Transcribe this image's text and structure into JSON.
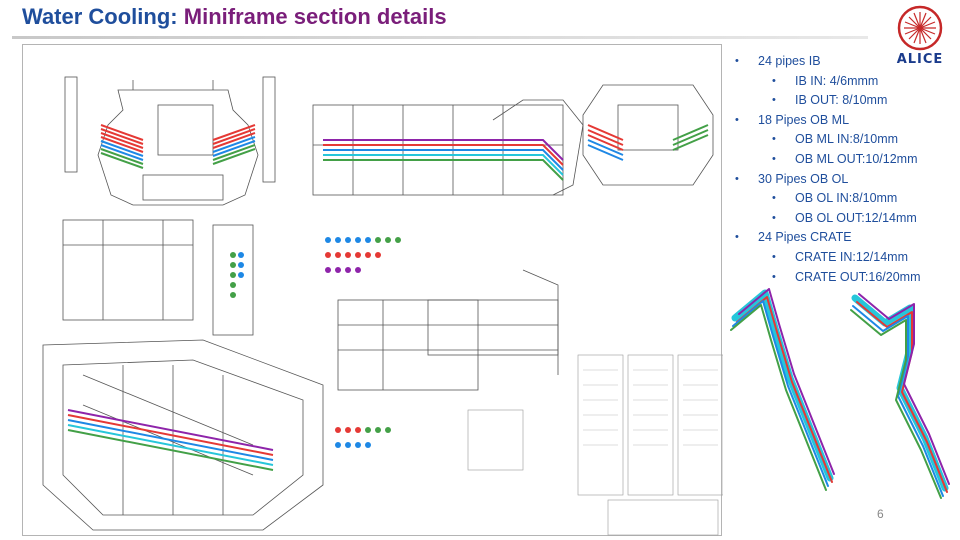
{
  "slide": {
    "title_part1": "Water Cooling:",
    "title_part2": "Miniframe section details",
    "page_number": "6"
  },
  "logo": {
    "text": "ALICE"
  },
  "bullets": [
    {
      "level": 1,
      "text": "24 pipes IB"
    },
    {
      "level": 2,
      "text": "IB IN: 4/6mmm"
    },
    {
      "level": 2,
      "text": "IB OUT: 8/10mm"
    },
    {
      "level": 1,
      "text": "18 Pipes OB ML"
    },
    {
      "level": 2,
      "text": "OB ML IN:8/10mm"
    },
    {
      "level": 2,
      "text": "OB ML OUT:10/12mm"
    },
    {
      "level": 1,
      "text": "30 Pipes OB OL"
    },
    {
      "level": 2,
      "text": "OB OL IN:8/10mm"
    },
    {
      "level": 2,
      "text": "OB OL OUT:12/14mm"
    },
    {
      "level": 1,
      "text": "24 Pipes CRATE"
    },
    {
      "level": 2,
      "text": "CRATE IN:12/14mm"
    },
    {
      "level": 2,
      "text": "CRATE OUT:16/20mm"
    }
  ],
  "colors": {
    "title_blue": "#1f4e9c",
    "title_purple": "#7a1e7a",
    "bullet_text": "#1f4e9c",
    "pipe_colors": [
      "#e53935",
      "#1e88e5",
      "#43a047",
      "#8e24aa",
      "#26c6da",
      "#fb8c00"
    ]
  }
}
